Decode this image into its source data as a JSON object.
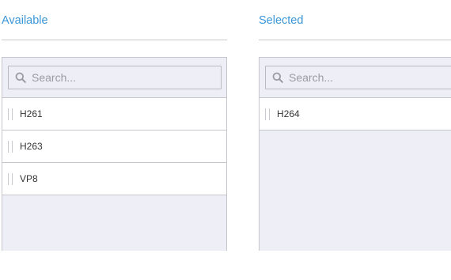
{
  "available": {
    "title": "Available",
    "search_placeholder": "Search...",
    "items": [
      {
        "label": "H261"
      },
      {
        "label": "H263"
      },
      {
        "label": "VP8"
      }
    ]
  },
  "selected": {
    "title": "Selected",
    "search_placeholder": "Search...",
    "items": [
      {
        "label": "H264"
      }
    ]
  },
  "colors": {
    "title": "#3b97d8",
    "list_background": "#eeeef6",
    "border": "#c6c6cc"
  },
  "icons": {
    "search": "search-icon",
    "drag": "drag-handle-icon"
  }
}
